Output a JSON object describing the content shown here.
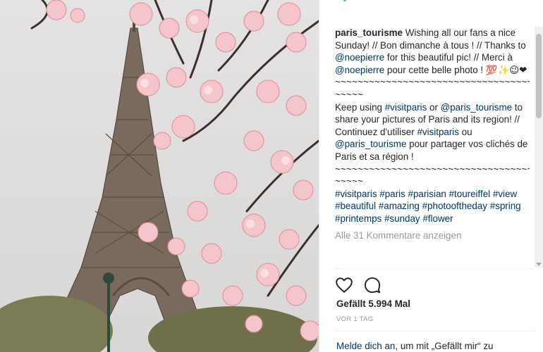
{
  "post": {
    "username": "paris_tourisme",
    "caption": {
      "line1_text": " Wishing all our fans a nice Sunday! // Bon dimanche à tous ! // Thanks to ",
      "mention1": "@noepierre",
      "line2_text": " for this beautiful pic! // Merci à ",
      "mention2": "@noepierre",
      "line3_text": " pour cette belle photo ! 💯✨😉❤",
      "tilde1": "~~~~~~~~~~~~~~~~~~~~~~~~~~~~~~~~~~~~~",
      "para2_text1": "Keep using ",
      "hashtag_visitparis": "#visitparis",
      "para2_text2": " or ",
      "mention3": "@paris_tourisme",
      "para2_text3": " to share your pictures of Paris and its region! // Continuez d'utiliser ",
      "hashtag_visitparis2": "#visitparis",
      "para2_text4": " ou ",
      "mention4": "@paris_tourisme",
      "para2_text5": " pour partager vos clichés de Paris et sa région !",
      "tilde2": "~~~~~~~~~~~~~~~~~~~~~~~~~~~~~~~~~~~~~",
      "hashtags": [
        "#visitparis",
        "#paris",
        "#parisian",
        "#toureiffel",
        "#view",
        "#beautiful",
        "#amazing",
        "#photooftheday",
        "#spring",
        "#printemps",
        "#sunday",
        "#flower"
      ]
    },
    "view_comments": "Alle 31 Kommentare anzeigen",
    "likes": "Gefällt 5.994 Mal",
    "timestamp": "VOR 1 TAG",
    "login_link": "Melde dich an",
    "login_rest": ", um mit „Gefällt mir“ zu"
  },
  "icons": {
    "like": "heart-outline-icon",
    "comment": "comment-bubble-icon"
  },
  "colors": {
    "link": "#003569",
    "muted": "#999999",
    "text": "#262626"
  }
}
